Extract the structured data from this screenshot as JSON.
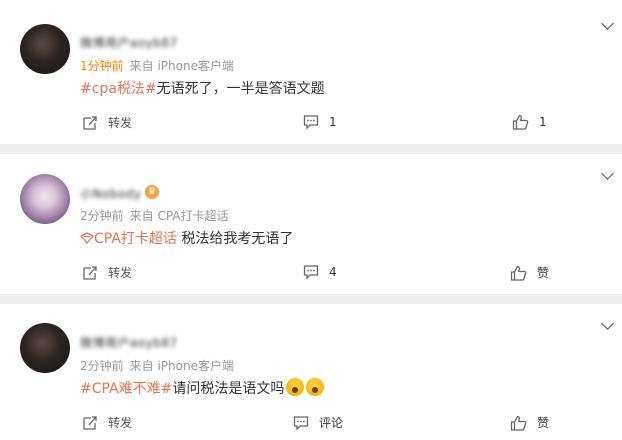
{
  "posts": [
    {
      "username": "微博用户aoyb87",
      "time": "1分钟前",
      "time_hot": true,
      "source": "来自 iPhone客户端",
      "tag": "#cpa税法#",
      "text": "无语死了，一半是答语文题",
      "actions": {
        "repost": "转发",
        "comment": "1",
        "like": "1"
      }
    },
    {
      "username": "小Nobody",
      "time": "2分钟前",
      "source": "来自 CPA打卡超话",
      "tag": "CPA打卡超话",
      "text": " 税法给我考无语了",
      "actions": {
        "repost": "转发",
        "comment": "4",
        "like": "赞"
      }
    },
    {
      "username": "微博用户aoyb87",
      "time": "2分钟前",
      "source": "来自 iPhone客户端",
      "tag": "#CPA难不难#",
      "text": "请问税法是语文吗",
      "actions": {
        "repost": "转发",
        "comment": "评论",
        "like": "赞"
      }
    }
  ],
  "icons": [
    "expand-chevron-icon",
    "repost-icon",
    "comment-icon",
    "like-icon",
    "super-topic-icon",
    "vip-crown-icon",
    "fearful-emoji-icon"
  ],
  "colors": {
    "tag": "#eb7350",
    "hot_time": "#ff8200",
    "meta": "#999999"
  }
}
